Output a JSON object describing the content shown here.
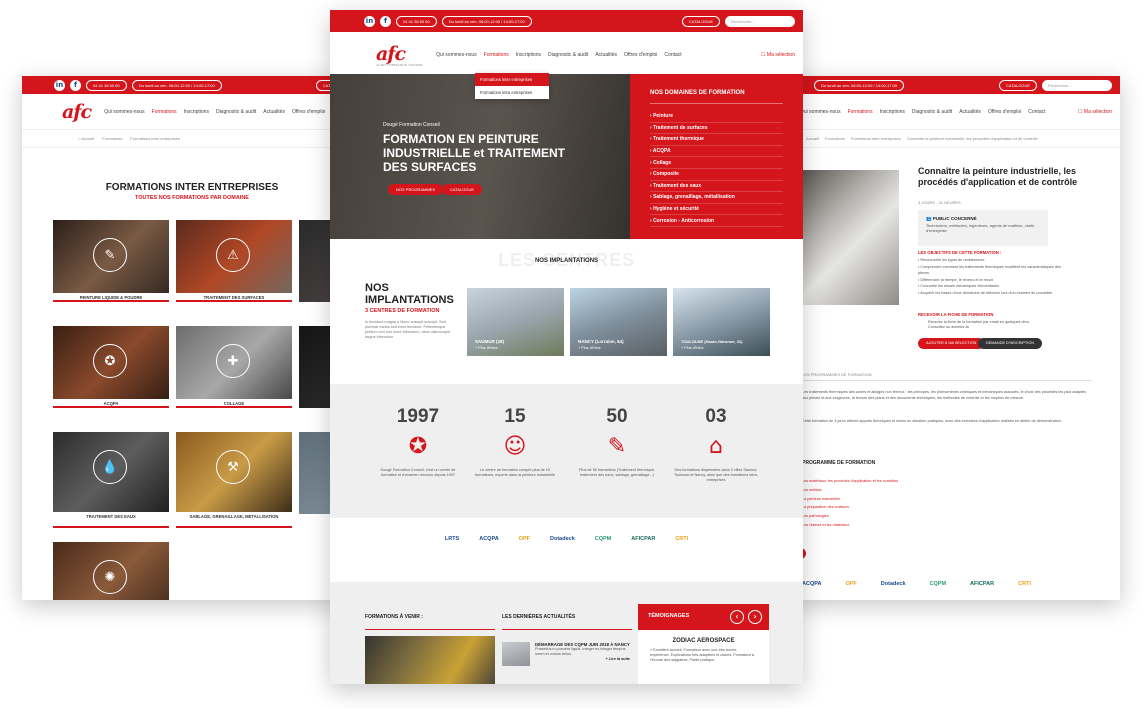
{
  "common": {
    "linkedin": "in",
    "facebook": "f",
    "phone": "04 41 38 60 60",
    "catalogue": "CATALOGUE",
    "search_placeholder": "Rechercher...",
    "logo": "afc",
    "logo_sub": "AUDIT FORMATION CONSEIL",
    "nav": [
      "Qui sommes-nous",
      "Formations",
      "Inscriptions",
      "Diagnostic & audit",
      "Actualités",
      "Offres d'emploi",
      "Contact"
    ],
    "ma_selection": "Ma sélection"
  },
  "left": {
    "breadcrumb": [
      "Accueil",
      "Formations",
      "Formations inter entreprises"
    ],
    "title": "FORMATIONS INTER ENTREPRISES",
    "subtitle": "TOUTES NOS FORMATIONS PAR DOMAINE",
    "tiles": [
      "PEINTURE LIQUIDE & POUDRE",
      "TRAITEMENT DES SURFACES",
      "",
      "ACQPA",
      "COLLAGE",
      "",
      "TRAITEMENT DES EAUX",
      "SABLAGE, GRENAILLAGE, METALLISATION",
      "",
      ""
    ]
  },
  "center": {
    "dropdown": [
      "Formations inter entreprises",
      "Formations intra entreprises"
    ],
    "hero": {
      "pretitle": "Dougé Formation Conseil",
      "title": "FORMATION EN PEINTURE INDUSTRIELLE et TRAITEMENT DES SURFACES",
      "btn1": "NOS PROGRAMMES",
      "btn2": "CATALOGUE"
    },
    "domains": {
      "title": "NOS DOMAINES DE FORMATION",
      "items": [
        "Peinture",
        "Traitement de surfaces",
        "Traitement thermique",
        "ACQPA",
        "Collage",
        "Composite",
        "Traitement des eaux",
        "Sablage, grenaillage, métallisation",
        "Hygiène et sécurité",
        "Corrosion - Anticorrosion"
      ]
    },
    "implantations": {
      "header": "NOS IMPLANTATIONS",
      "title": "NOS IMPLANTATIONS",
      "subtitle": "3 CENTRES DE FORMATION",
      "text": "In tincidunt magna a libero suscipit suscipit. Sed pulvinar metus sed enim tincidunt. Pellentesque pretium orci non dolor bibendum, vitae ullamcorper augue bibendum.",
      "places": [
        {
          "name": "SAUMUR (49)",
          "more": "+ Plus d'infos"
        },
        {
          "name": "NANCY (Lorraine, 54)",
          "more": "+ Plus d'infos"
        },
        {
          "name": "TOULOUSE (Haute-Garonne, 31)",
          "more": "+ Plus d'infos"
        }
      ]
    },
    "stats": [
      {
        "num": "1997",
        "txt": "Dougé Formation Conseil, c'est un centre de formation et d'examen reconnu depuis 1997"
      },
      {
        "num": "15",
        "txt": "Le centre de formation compte plus de 15 formateurs, experts dans la peinture industrielle"
      },
      {
        "num": "50",
        "txt": "Plus de 50 formations (Traitement thermique, traitement des eaux, sablage, grenaillage...)"
      },
      {
        "num": "03",
        "txt": "Des formations dispensées dans 3 villes Saumur, Toulouse et Nancy, ainsi que des formations intra-entreprises"
      }
    ],
    "partners": [
      "LRTS",
      "ACQPA",
      "OPF",
      "Dotadeck",
      "CQPM",
      "AFICPAR",
      "CRTI"
    ],
    "bottom": {
      "formations": "FORMATIONS À VENIR :",
      "actus": "LES DERNIÈRES ACTUALITÉS",
      "actu_title": "DÉMARRAGE DES CQPM JUIN 2018 À NANCY",
      "actu_text": "Phasellus in posuere ligula. Integer eu integer tempus lorem et cursus tellus.",
      "actu_more": "+ Lire la suite",
      "temoignages": "TÉMOIGNAGES",
      "brand": "ZODIAC AEROSPACE",
      "quote": "« Excellent accueil. Formateur avec une très bonne expérience. Explications très adaptées et claires. Formateur à l'écoute des stagiaires. Partie pratique"
    }
  },
  "right": {
    "breadcrumb": [
      "Accueil",
      "Formations",
      "Formations inter entreprises",
      "Connaître la peinture industrielle, les procédés d'application et de contrôle"
    ],
    "title": "Connaître la peinture industrielle, les procédés d'application et de contrôle",
    "meta": "3 JOURS - 21 HEURES",
    "public_title": "PUBLIC CONCERNÉ",
    "public_text": "Techniciens, méthodes, ingénieurs, agents de maîtrise, chefs d'entreprise",
    "objectifs_title": "LES OBJECTIFS DE CETTE FORMATION :",
    "objectifs": [
      "Reconnaître les types de revêtements",
      "Comprendre comment les traitements thermiques modifient les caractéristiques des pièces",
      "Différencier la trempe, le revenu et le recuit",
      "Connaître les essais mécaniques élémentaires",
      "Acquérir les bases d'une démarche de réflexion lors d'un examen de procédés"
    ],
    "fiche_title": "RECEVOIR LA FICHE DE FORMATION",
    "fiche_text": "Recevez la fiche de la formation par email en quelques clics. Consultez ou achetez-la",
    "btn_selection": "AJOUTER À MA SÉLECTION",
    "btn_inscription": "DEMANDE D'INSCRIPTION",
    "tab": "LES PROGRAMMES DE FORMATION",
    "para1": "Les traitements thermiques des aciers et alliages non ferreux : les principes, les phénomènes chimiques et mécaniques associés, le choix des procédés les plus adaptés aux pièces et aux exigences, la lecture des plans et des documents techniques, les méthodes de contrôle et les moyens de mesure.",
    "para2": "Cette formation de 3 jours alterne apports théoriques et mises en situation pratiques, avec des exercices d'application réalisés en atelier de démonstration.",
    "program_title": "PROGRAMME DE FORMATION",
    "program": [
      "Les matériaux, les procédés d'application et les contrôles",
      "Les métaux",
      "La peinture industrielle",
      "La préparation des surfaces",
      "Les pathologies",
      "Les résines et les matériaux"
    ],
    "partners": [
      "ACQPA",
      "OPF",
      "Dotadeck",
      "CQPM",
      "AFICPAR",
      "CRTI"
    ]
  }
}
